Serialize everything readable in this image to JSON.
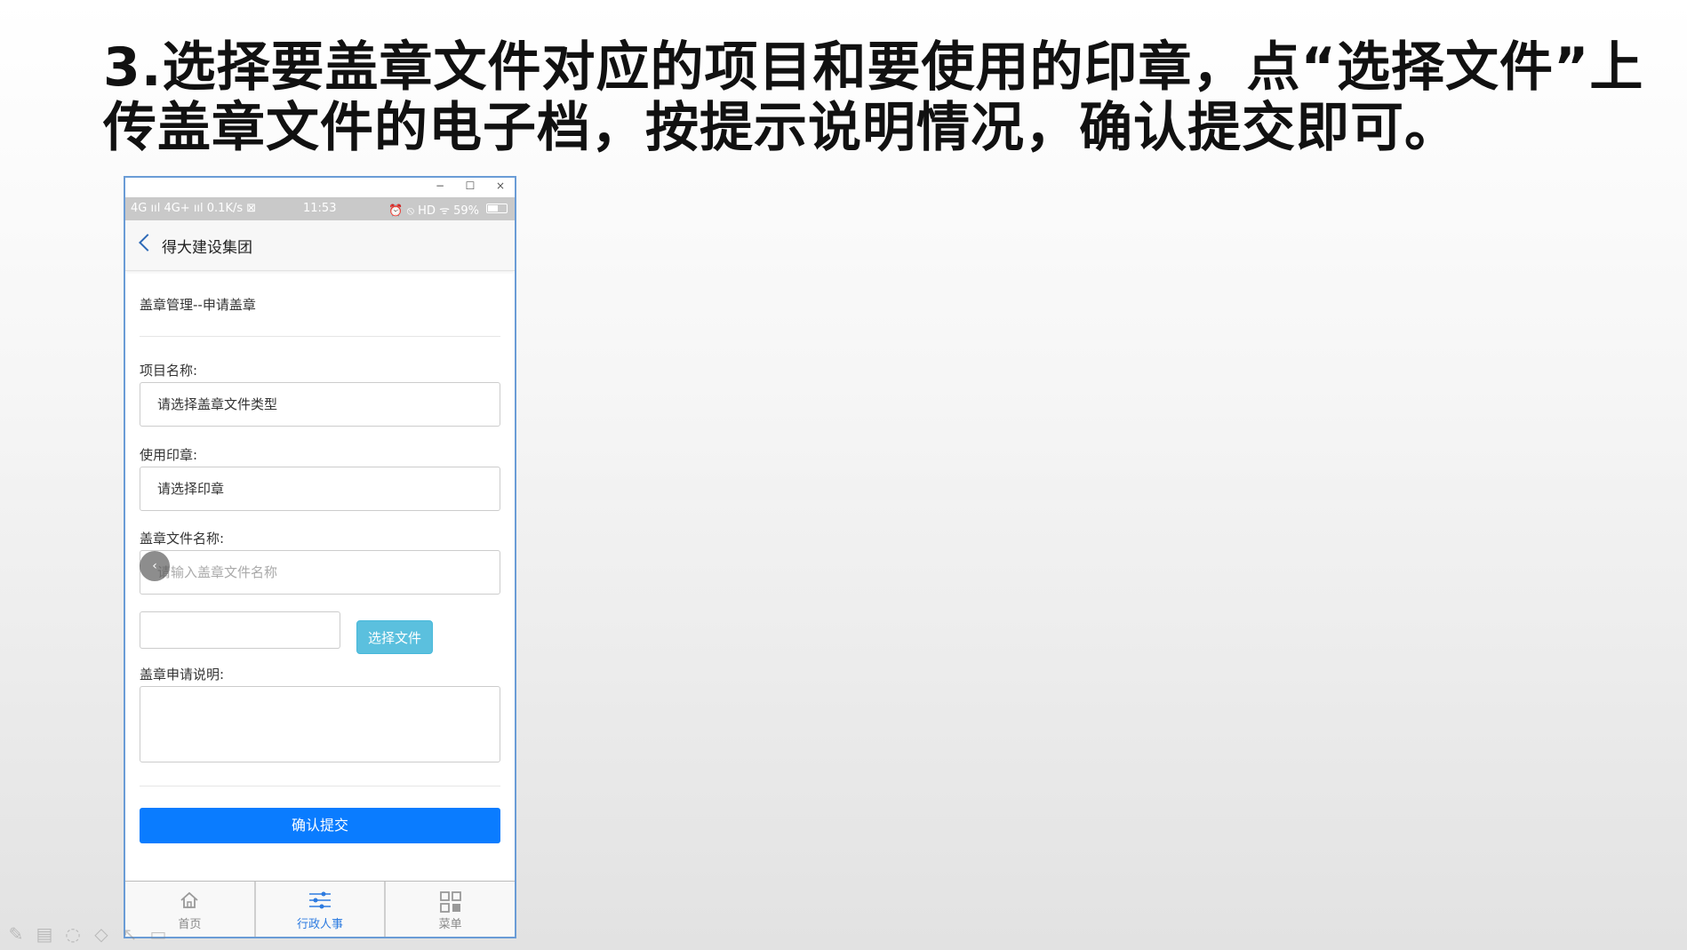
{
  "slide": {
    "title_line1": "3.选择要盖章文件对应的项目和要使用的印章，点“选择文件”上",
    "title_line2": "传盖章文件的电子档，按提示说明情况，确认提交即可。"
  },
  "window": {
    "minimize": "−",
    "maximize": "☐",
    "close": "×"
  },
  "status_bar": {
    "left": "4G ııl 4G+ ııl 0.1K/s ⊠",
    "time": "11:53",
    "right": "⏰ ⦸ HD ᯤ 59%",
    "battery_level": 0.59
  },
  "nav": {
    "title": "得大建设集团"
  },
  "form": {
    "breadcrumb": "盖章管理--申请盖章",
    "project_label": "项目名称:",
    "project_value": "请选择盖章文件类型",
    "seal_label": "使用印章:",
    "seal_value": "请选择印章",
    "filename_label": "盖章文件名称:",
    "filename_placeholder": "请输入盖章文件名称",
    "choose_file_label": "选择文件",
    "description_label": "盖章申请说明:",
    "submit_label": "确认提交"
  },
  "tabs": [
    {
      "label": "首页",
      "icon": "home-icon"
    },
    {
      "label": "行政人事",
      "icon": "sliders-icon"
    },
    {
      "label": "菜单",
      "icon": "grid-icon"
    }
  ],
  "colors": {
    "primary": "#0a7cff",
    "info": "#5bc0de",
    "active_tab": "#2d7be0",
    "frame": "#6a9cd6"
  }
}
